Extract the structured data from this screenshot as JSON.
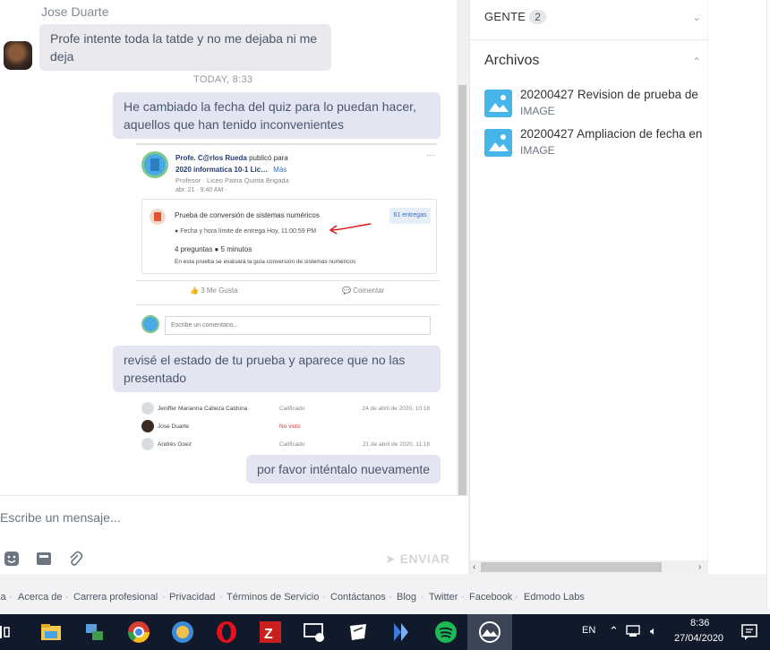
{
  "chat": {
    "sender_name": "Jose Duarte",
    "incoming_message": "Profe intente toda la tatde y no me dejaba ni me deja",
    "time_separator": "TODAY, 8:33",
    "outgoing_messages": [
      "He cambiado la fecha del quiz para lo puedan hacer, aquellos que han tenido inconvenientes",
      "revisé el estado de tu prueba y aparece que no las presentado",
      "por favor inténtalo nuevamente"
    ]
  },
  "post_screenshot": {
    "author": "Profe. C@rlos Rueda",
    "published_for": "publicó para",
    "group": "2020 informatica 10-1 Lic…",
    "more": "Más",
    "author_meta": "Profesor · Liceo Patria Quinta Brigada",
    "date": "abr. 21 · 9:40 AM ·",
    "more_menu": "···",
    "quiz_title": "Prueba de conversión de sistemas numéricos",
    "deadline": "Fecha y hora límite de entrega Hoy, 11:00:59 PM",
    "submissions": "61 entregas",
    "quiz_meta": "4 preguntas ● 5 minutos",
    "quiz_desc": "En esta prueba se evaluará la guía conversión de sistemas numéricos",
    "like": "3 Me Gusta",
    "comment": "Comentar",
    "comment_placeholder": "Escribe un comentario..."
  },
  "grades_screenshot": {
    "rows": [
      {
        "name": "Jeniffer Marianna Cabeza Caldona",
        "status": "Calificado",
        "date": "24 de abril de 2020, 10:18"
      },
      {
        "name": "Jose Duarte",
        "status": "No visto",
        "date": ""
      },
      {
        "name": "Andrés Goez",
        "status": "Calificado",
        "date": "21 de abril de 2020, 11:18"
      }
    ]
  },
  "composer": {
    "placeholder": "Escribe un mensaje...",
    "send_label": "ENVIAR"
  },
  "panel": {
    "people_label": "GENTE",
    "people_count": "2",
    "files_label": "Archivos",
    "files": [
      {
        "name": "20200427 Revision de prueba de",
        "type": "IMAGE"
      },
      {
        "name": "20200427 Ampliacion de fecha en",
        "type": "IMAGE"
      }
    ]
  },
  "footer": {
    "links": [
      "ia",
      "Acerca de",
      "Carrera profesional",
      "Privacidad",
      "Términos de Servicio",
      "Contáctanos",
      "Blog",
      "Twitter",
      "Facebook",
      "Edmodo Labs"
    ]
  },
  "taskbar": {
    "language": "EN",
    "time": "8:36",
    "date": "27/04/2020"
  },
  "colors": {
    "outgoing_bubble": "#e3e5f2",
    "incoming_bubble": "#e9e9ee",
    "file_icon": "#46b6ea",
    "taskbar": "#101a2b"
  }
}
